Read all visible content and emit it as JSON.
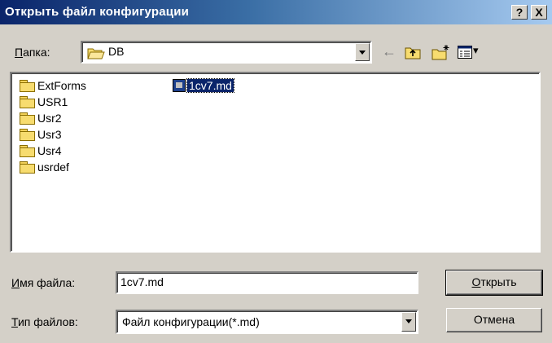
{
  "window": {
    "title": "Открыть файл конфигурации",
    "help_label": "?",
    "close_label": "X"
  },
  "lookin": {
    "label_underline": "П",
    "label_rest": "апка:",
    "value": "DB"
  },
  "toolbar": {
    "back_glyph": "←",
    "view_menu_glyph": "▾"
  },
  "files": [
    {
      "name": "ExtForms",
      "kind": "folder"
    },
    {
      "name": "USR1",
      "kind": "folder"
    },
    {
      "name": "Usr2",
      "kind": "folder"
    },
    {
      "name": "Usr3",
      "kind": "folder"
    },
    {
      "name": "Usr4",
      "kind": "folder"
    },
    {
      "name": "usrdef",
      "kind": "folder"
    },
    {
      "name": "1cv7.md",
      "kind": "file",
      "selected": true
    }
  ],
  "filename": {
    "label_underline": "И",
    "label_rest": "мя файла:",
    "value": "1cv7.md"
  },
  "filetype": {
    "label_underline": "Т",
    "label_rest": "ип файлов:",
    "value": "Файл конфигурации(*.md)"
  },
  "buttons": {
    "open_underline": "О",
    "open_rest": "ткрыть",
    "cancel": "Отмена"
  }
}
